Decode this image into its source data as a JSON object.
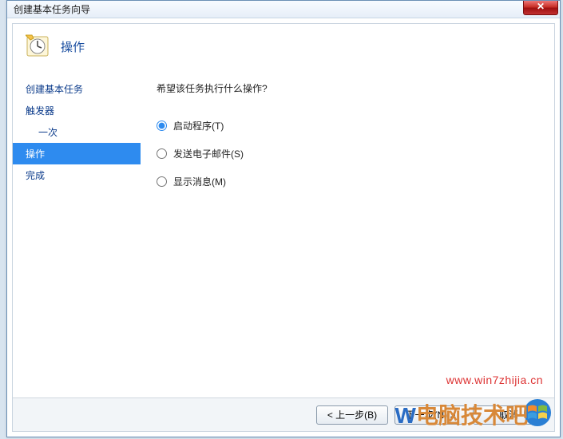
{
  "window": {
    "title": "创建基本任务向导",
    "close_label": "✕"
  },
  "header": {
    "title": "操作"
  },
  "sidebar": {
    "items": [
      {
        "label": "创建基本任务",
        "indent": false,
        "selected": false
      },
      {
        "label": "触发器",
        "indent": false,
        "selected": false
      },
      {
        "label": "一次",
        "indent": true,
        "selected": false
      },
      {
        "label": "操作",
        "indent": false,
        "selected": true
      },
      {
        "label": "完成",
        "indent": false,
        "selected": false
      }
    ]
  },
  "main": {
    "question": "希望该任务执行什么操作?",
    "options": [
      {
        "label": "启动程序(T)",
        "checked": true
      },
      {
        "label": "发送电子邮件(S)",
        "checked": false
      },
      {
        "label": "显示消息(M)",
        "checked": false
      }
    ]
  },
  "footer": {
    "back": "< 上一步(B)",
    "next": "下一步(N) >",
    "cancel": "取消"
  },
  "watermarks": {
    "url": "www.win7zhijia.cn",
    "text_a": "W",
    "text_b": "电脑技术吧"
  }
}
